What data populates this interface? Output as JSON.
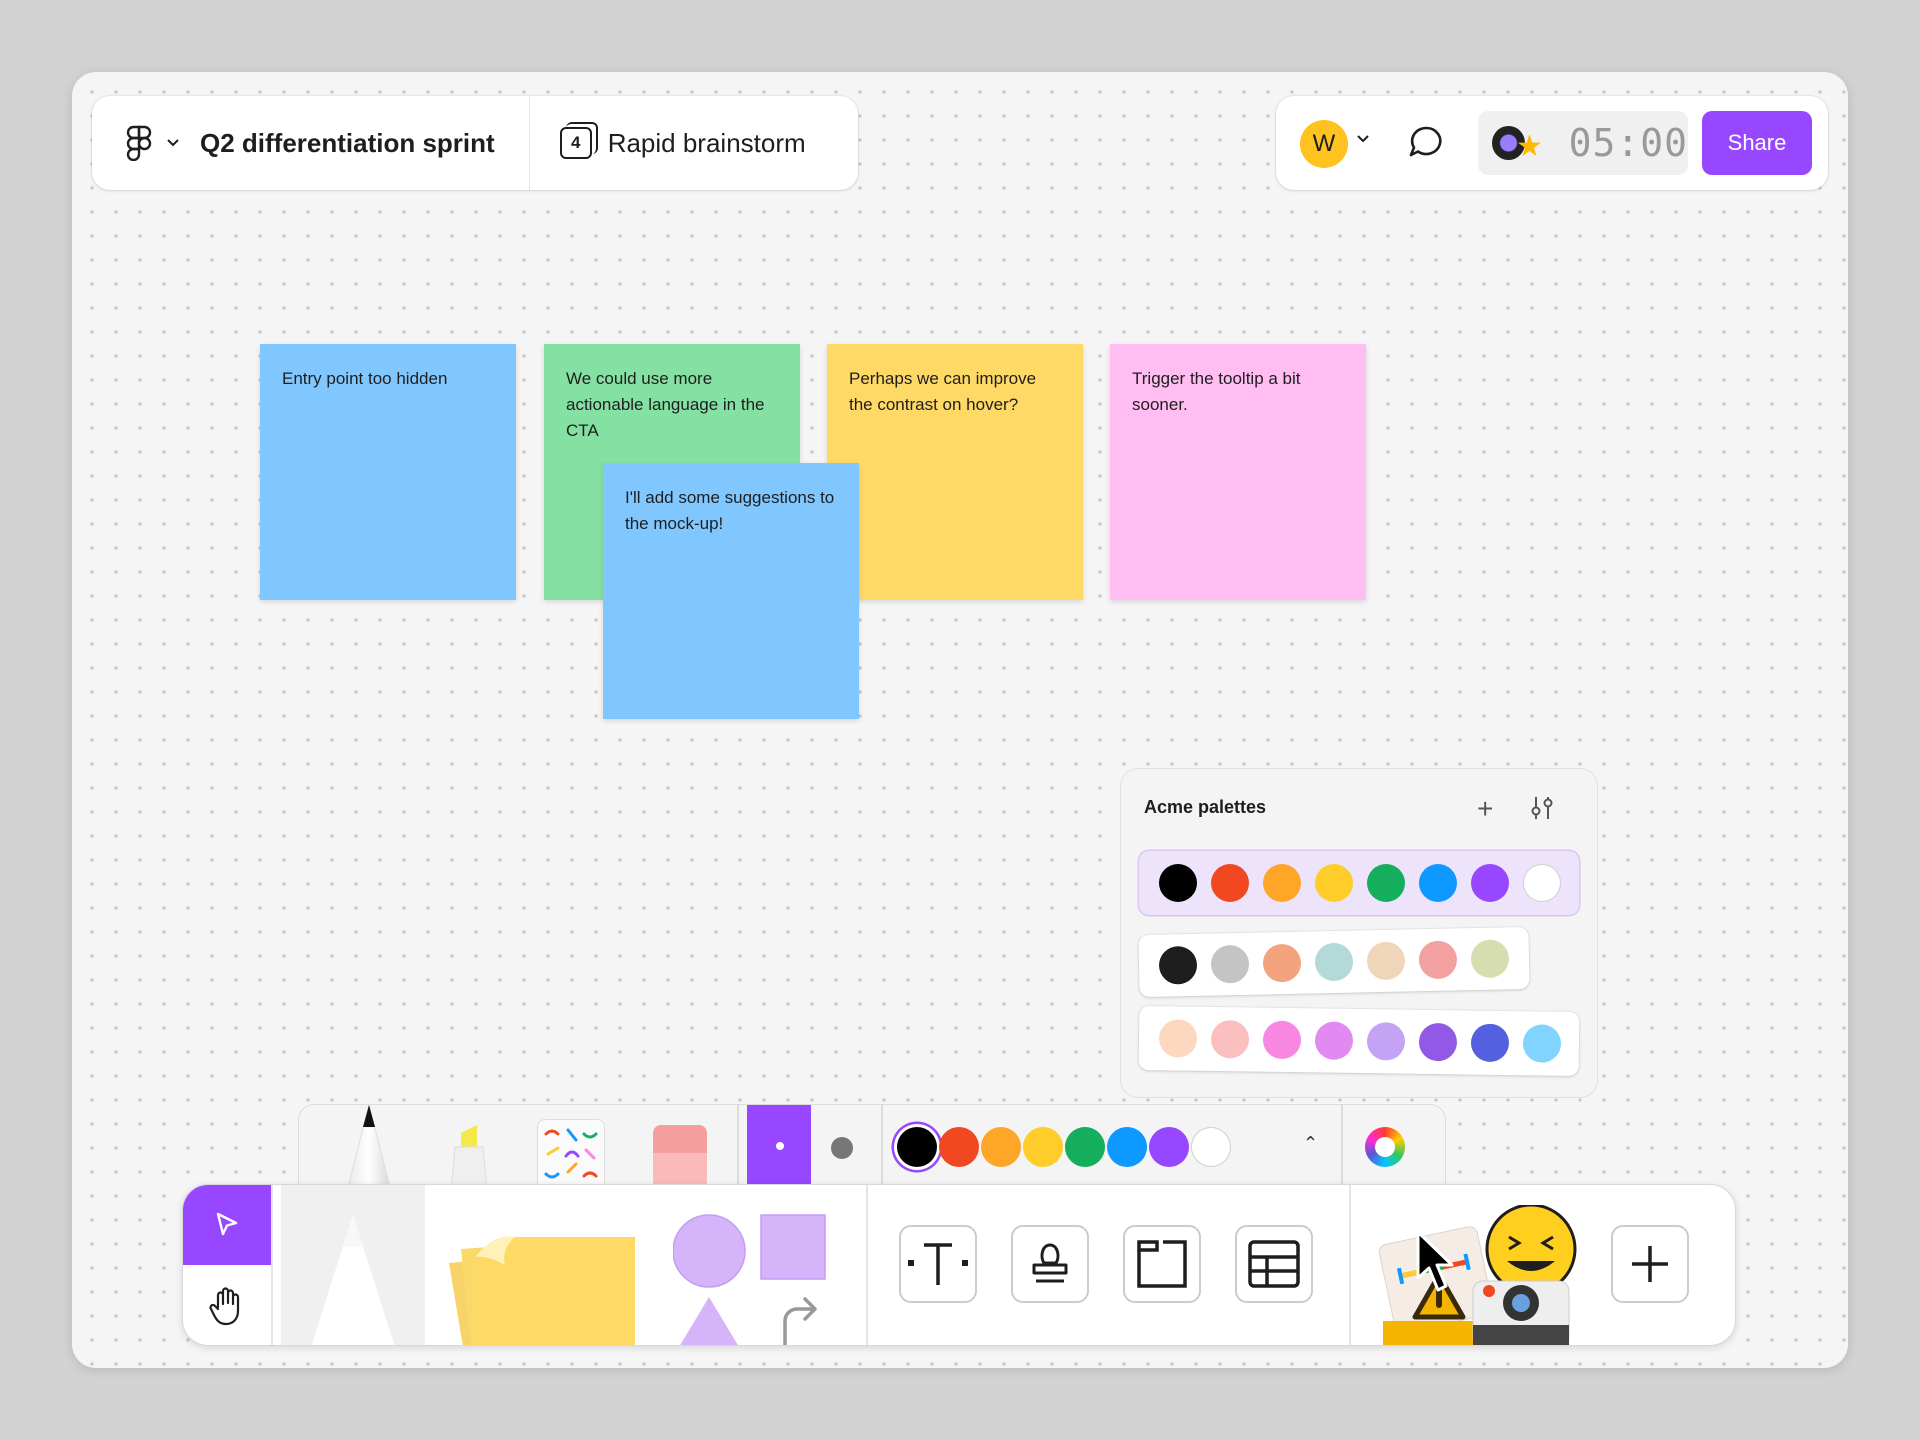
{
  "topbar": {
    "file_title": "Q2 differentiation sprint",
    "page_count": "4",
    "page_title": "Rapid brainstorm"
  },
  "collab": {
    "avatar_initial": "W",
    "timer": "05:00",
    "share_label": "Share"
  },
  "stickies": [
    {
      "text": "Entry point too hidden",
      "color": "#80c7ff"
    },
    {
      "text": "We could use more actionable language in the CTA",
      "color": "#85e0a3"
    },
    {
      "text": "Perhaps we can improve the contrast on hover?",
      "color": "#ffd966"
    },
    {
      "text": "Trigger the tooltip a bit sooner.",
      "color": "#ffbdf2"
    },
    {
      "text": "I'll add some suggestions to the mock-up!",
      "color": "#80c7ff"
    }
  ],
  "palettes": {
    "title": "Acme palettes",
    "rows": [
      [
        "#000000",
        "#f24822",
        "#ffa629",
        "#ffcd29",
        "#14ae5c",
        "#0d99ff",
        "#9747ff",
        "#ffffff"
      ],
      [
        "#1e1e1e",
        "#c4c4c4",
        "#f3a37e",
        "#b3d9d9",
        "#f0d6b8",
        "#f2a0a0",
        "#d6deb0"
      ],
      [
        "#fcd8c0",
        "#fbbfbf",
        "#f787e0",
        "#e08af2",
        "#c4a3f5",
        "#9258e6",
        "#5460de",
        "#80d4ff"
      ]
    ]
  },
  "tray_colors": [
    "#000000",
    "#f24822",
    "#ffa629",
    "#ffcd29",
    "#14ae5c",
    "#0d99ff",
    "#9747ff",
    "#ffffff"
  ],
  "accent": "#9747ff"
}
